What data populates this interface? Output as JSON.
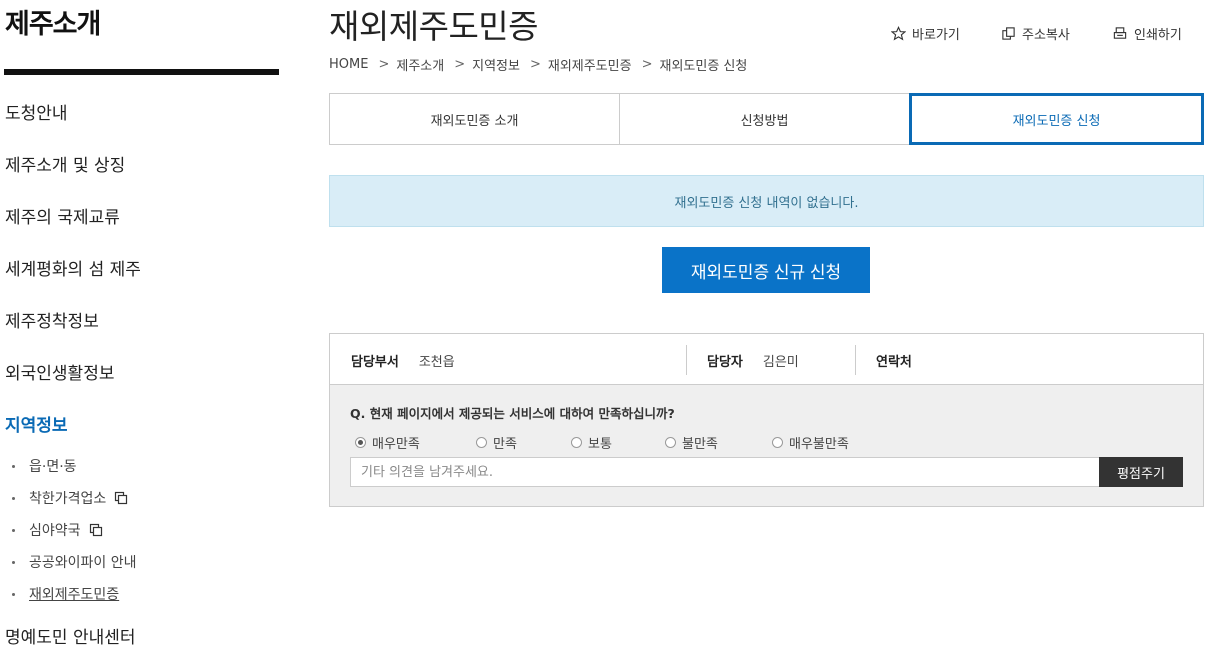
{
  "sidebar": {
    "title": "제주소개",
    "menu": [
      {
        "label": "도청안내"
      },
      {
        "label": "제주소개 및 상징"
      },
      {
        "label": "제주의 국제교류"
      },
      {
        "label": "세계평화의 섬 제주"
      },
      {
        "label": "제주정착정보"
      },
      {
        "label": "외국인생활정보"
      },
      {
        "label": "지역정보"
      }
    ],
    "submenu": [
      {
        "label": "읍·면·동",
        "external": false
      },
      {
        "label": "착한가격업소",
        "external": true
      },
      {
        "label": "심야약국",
        "external": true
      },
      {
        "label": "공공와이파이 안내",
        "external": false
      },
      {
        "label": "재외제주도민증",
        "external": false
      }
    ],
    "bottom_item": "명예도민 안내센터",
    "active_color": "#0a6ab5"
  },
  "header": {
    "title": "재외제주도민증",
    "utils": {
      "shortcut": "바로가기",
      "copy_address": "주소복사",
      "print": "인쇄하기"
    },
    "breadcrumb": [
      "HOME",
      "제주소개",
      "지역정보",
      "재외제주도민증",
      "재외도민증 신청"
    ]
  },
  "tabs": [
    {
      "label": "재외도민증 소개"
    },
    {
      "label": "신청방법"
    },
    {
      "label": "재외도민증 신청"
    }
  ],
  "notice": "재외도민증 신청 내역이 없습니다.",
  "apply_button": "재외도민증 신규 신청",
  "contact": {
    "dept_label": "담당부서",
    "dept_value": "조천읍",
    "person_label": "담당자",
    "person_value": "김은미",
    "phone_label": "연락처",
    "phone_value": ""
  },
  "survey": {
    "question": "Q. 현재 페이지에서 제공되는 서비스에 대하여 만족하십니까?",
    "options": [
      "매우만족",
      "만족",
      "보통",
      "불만족",
      "매우불만족"
    ],
    "selected": "매우만족",
    "comment_placeholder": "기타 의견을 남겨주세요.",
    "submit_label": "평점주기"
  },
  "colors": {
    "accent": "#0a6ab5",
    "button": "#0a73c8",
    "notice_bg": "#d9edf7",
    "dark_button": "#333333"
  }
}
